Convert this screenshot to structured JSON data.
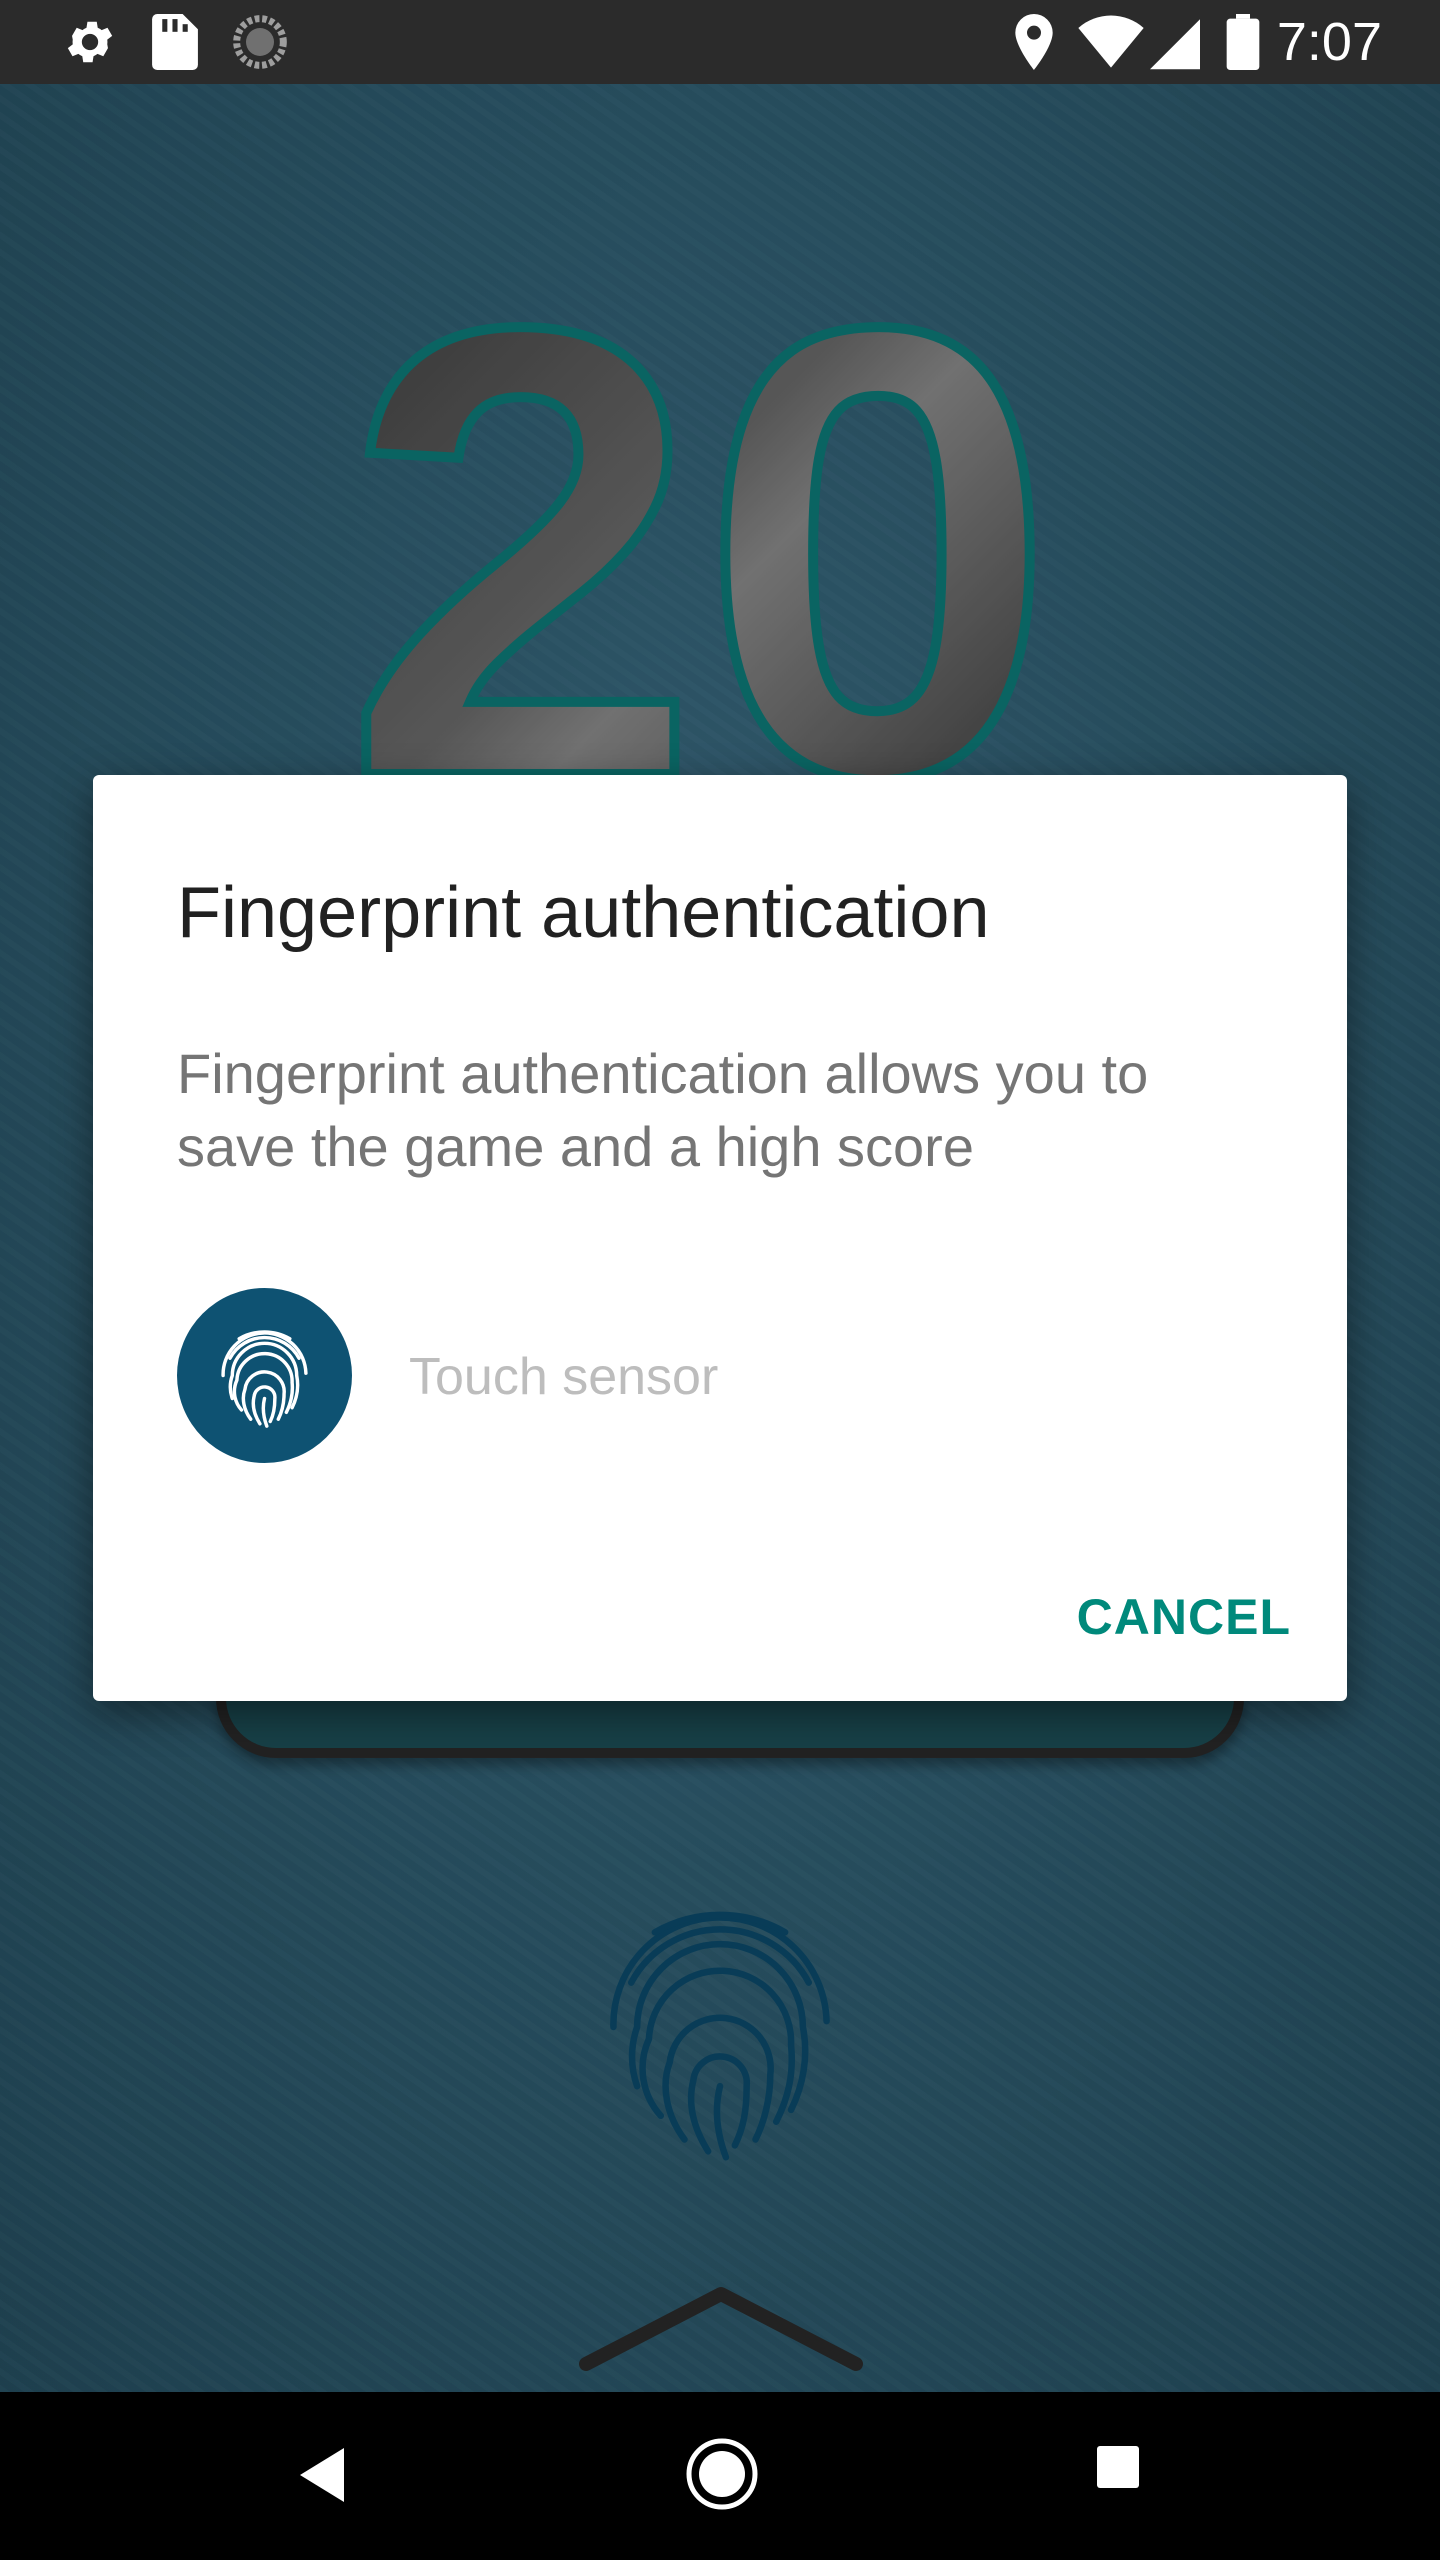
{
  "status_bar": {
    "time": "7:07",
    "left_icons": [
      "gear-icon",
      "sd-card-icon",
      "sync-icon"
    ],
    "right_icons": [
      "location-icon",
      "wifi-icon",
      "signal-icon",
      "battery-icon"
    ]
  },
  "game": {
    "score": "20",
    "background_color": "#305f73"
  },
  "dialog": {
    "title": "Fingerprint authentication",
    "description": "Fingerprint authentication allows you to save the game and a high score",
    "sensor_label": "Touch sensor",
    "cancel_label": "CANCEL",
    "accent_color": "#00897b",
    "fingerprint_circle_color": "#0e5272"
  },
  "nav_bar": {
    "buttons": [
      "back-icon",
      "home-icon",
      "recents-icon"
    ]
  }
}
